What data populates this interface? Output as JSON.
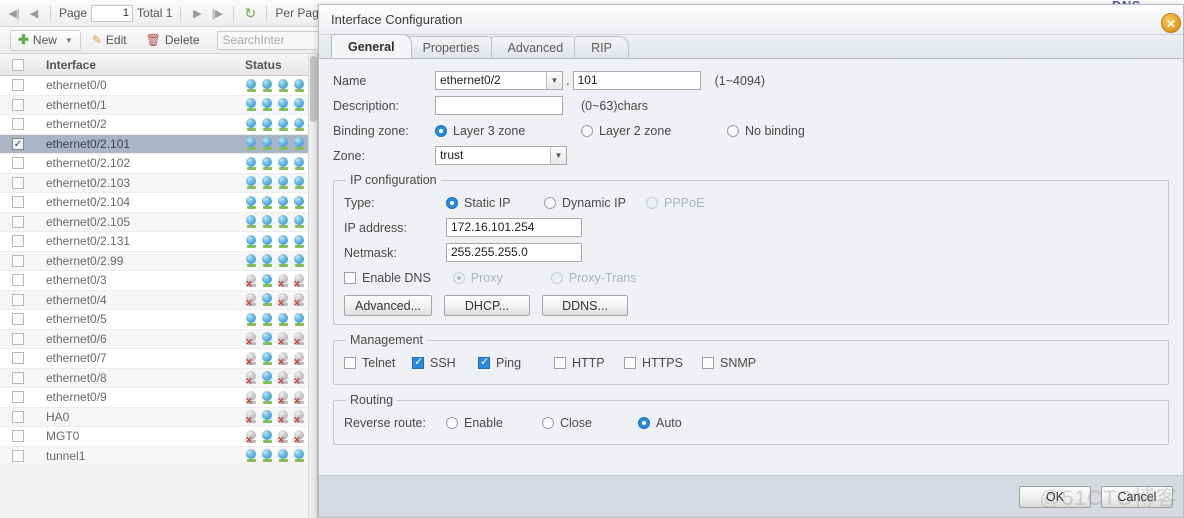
{
  "background": {
    "pager": {
      "first_icon": "first-page-icon",
      "prev_icon": "prev-page-icon",
      "page_label": "Page",
      "page_value": "1",
      "total_label": "Total 1",
      "next_icon": "next-page-icon",
      "last_icon": "last-page-icon",
      "refresh_icon": "refresh-icon",
      "per_page_label": "Per Page"
    },
    "toolbar": {
      "new_label": "New",
      "edit_label": "Edit",
      "delete_label": "Delete",
      "search_placeholder": "SearchInter"
    },
    "table": {
      "columns": [
        "",
        "Interface",
        "Status"
      ],
      "rows": [
        {
          "name": "ethernet0/0",
          "selected": false,
          "status": [
            "up",
            "up",
            "up",
            "up"
          ]
        },
        {
          "name": "ethernet0/1",
          "selected": false,
          "status": [
            "up",
            "up",
            "up",
            "up"
          ]
        },
        {
          "name": "ethernet0/2",
          "selected": false,
          "status": [
            "up",
            "up",
            "up",
            "up"
          ]
        },
        {
          "name": "ethernet0/2.101",
          "selected": true,
          "status": [
            "up",
            "up",
            "up",
            "up"
          ]
        },
        {
          "name": "ethernet0/2.102",
          "selected": false,
          "status": [
            "up",
            "up",
            "up",
            "up"
          ]
        },
        {
          "name": "ethernet0/2.103",
          "selected": false,
          "status": [
            "up",
            "up",
            "up",
            "up"
          ]
        },
        {
          "name": "ethernet0/2.104",
          "selected": false,
          "status": [
            "up",
            "up",
            "up",
            "up"
          ]
        },
        {
          "name": "ethernet0/2.105",
          "selected": false,
          "status": [
            "up",
            "up",
            "up",
            "up"
          ]
        },
        {
          "name": "ethernet0/2.131",
          "selected": false,
          "status": [
            "up",
            "up",
            "up",
            "up"
          ]
        },
        {
          "name": "ethernet0/2.99",
          "selected": false,
          "status": [
            "up",
            "up",
            "up",
            "up"
          ]
        },
        {
          "name": "ethernet0/3",
          "selected": false,
          "status": [
            "down",
            "up",
            "down",
            "down"
          ]
        },
        {
          "name": "ethernet0/4",
          "selected": false,
          "status": [
            "down",
            "up",
            "down",
            "down"
          ]
        },
        {
          "name": "ethernet0/5",
          "selected": false,
          "status": [
            "up",
            "up",
            "up",
            "up"
          ]
        },
        {
          "name": "ethernet0/6",
          "selected": false,
          "status": [
            "down",
            "up",
            "down",
            "down"
          ]
        },
        {
          "name": "ethernet0/7",
          "selected": false,
          "status": [
            "down",
            "up",
            "down",
            "down"
          ]
        },
        {
          "name": "ethernet0/8",
          "selected": false,
          "status": [
            "down",
            "up",
            "down",
            "down"
          ]
        },
        {
          "name": "ethernet0/9",
          "selected": false,
          "status": [
            "down",
            "up",
            "down",
            "down"
          ]
        },
        {
          "name": "HA0",
          "selected": false,
          "status": [
            "down",
            "up",
            "down",
            "down"
          ]
        },
        {
          "name": "MGT0",
          "selected": false,
          "status": [
            "down",
            "up",
            "down",
            "down"
          ]
        },
        {
          "name": "tunnel1",
          "selected": false,
          "status": [
            "up",
            "up",
            "up",
            "up"
          ]
        }
      ]
    },
    "ghost_text": "DNS"
  },
  "dialog": {
    "title": "Interface Configuration",
    "close_icon": "close-icon",
    "tabs": [
      {
        "label": "General",
        "active": true
      },
      {
        "label": "Properties",
        "active": false
      },
      {
        "label": "Advanced",
        "active": false
      },
      {
        "label": "RIP",
        "active": false
      }
    ],
    "general": {
      "name_label": "Name",
      "name_interface": "ethernet0/2",
      "name_separator": ".",
      "name_vlan": "101",
      "name_hint": "(1~4094)",
      "description_label": "Description:",
      "description_value": "",
      "description_hint": "(0~63)chars",
      "binding_zone_label": "Binding zone:",
      "binding_zone_options": [
        {
          "label": "Layer 3 zone",
          "selected": true,
          "disabled": false
        },
        {
          "label": "Layer 2 zone",
          "selected": false,
          "disabled": false
        },
        {
          "label": "No binding",
          "selected": false,
          "disabled": false
        }
      ],
      "zone_label": "Zone:",
      "zone_value": "trust",
      "ip_configuration": {
        "legend": "IP configuration",
        "type_label": "Type:",
        "type_options": [
          {
            "label": "Static IP",
            "selected": true,
            "disabled": false
          },
          {
            "label": "Dynamic IP",
            "selected": false,
            "disabled": false
          },
          {
            "label": "PPPoE",
            "selected": false,
            "disabled": true
          }
        ],
        "ip_address_label": "IP address:",
        "ip_address_value": "172.16.101.254",
        "netmask_label": "Netmask:",
        "netmask_value": "255.255.255.0",
        "enable_dns_label": "Enable DNS",
        "enable_dns_checked": false,
        "dns_options": [
          {
            "label": "Proxy",
            "selected": true,
            "disabled": true
          },
          {
            "label": "Proxy-Trans",
            "selected": false,
            "disabled": true
          }
        ],
        "buttons": [
          {
            "label": "Advanced..."
          },
          {
            "label": "DHCP..."
          },
          {
            "label": "DDNS..."
          }
        ]
      },
      "management": {
        "legend": "Management",
        "options": [
          {
            "label": "Telnet",
            "checked": false
          },
          {
            "label": "SSH",
            "checked": true
          },
          {
            "label": "Ping",
            "checked": true
          },
          {
            "label": "HTTP",
            "checked": false
          },
          {
            "label": "HTTPS",
            "checked": false
          },
          {
            "label": "SNMP",
            "checked": false
          }
        ]
      },
      "routing": {
        "legend": "Routing",
        "reverse_route_label": "Reverse route:",
        "options": [
          {
            "label": "Enable",
            "selected": false
          },
          {
            "label": "Close",
            "selected": false
          },
          {
            "label": "Auto",
            "selected": true
          }
        ]
      }
    },
    "footer": {
      "ok_label": "OK",
      "cancel_label": "Cancel"
    }
  },
  "watermark": "@51CTO博客",
  "colors": {
    "accent": "#2a8ae0",
    "selected_row": "#a9b4c4",
    "dialog_bg": "#eef0f3",
    "footer_bg": "#d6d9e0",
    "status_up": "#63b6e0",
    "status_down": "#c6c6c6",
    "close_button": "#e8a32a"
  }
}
